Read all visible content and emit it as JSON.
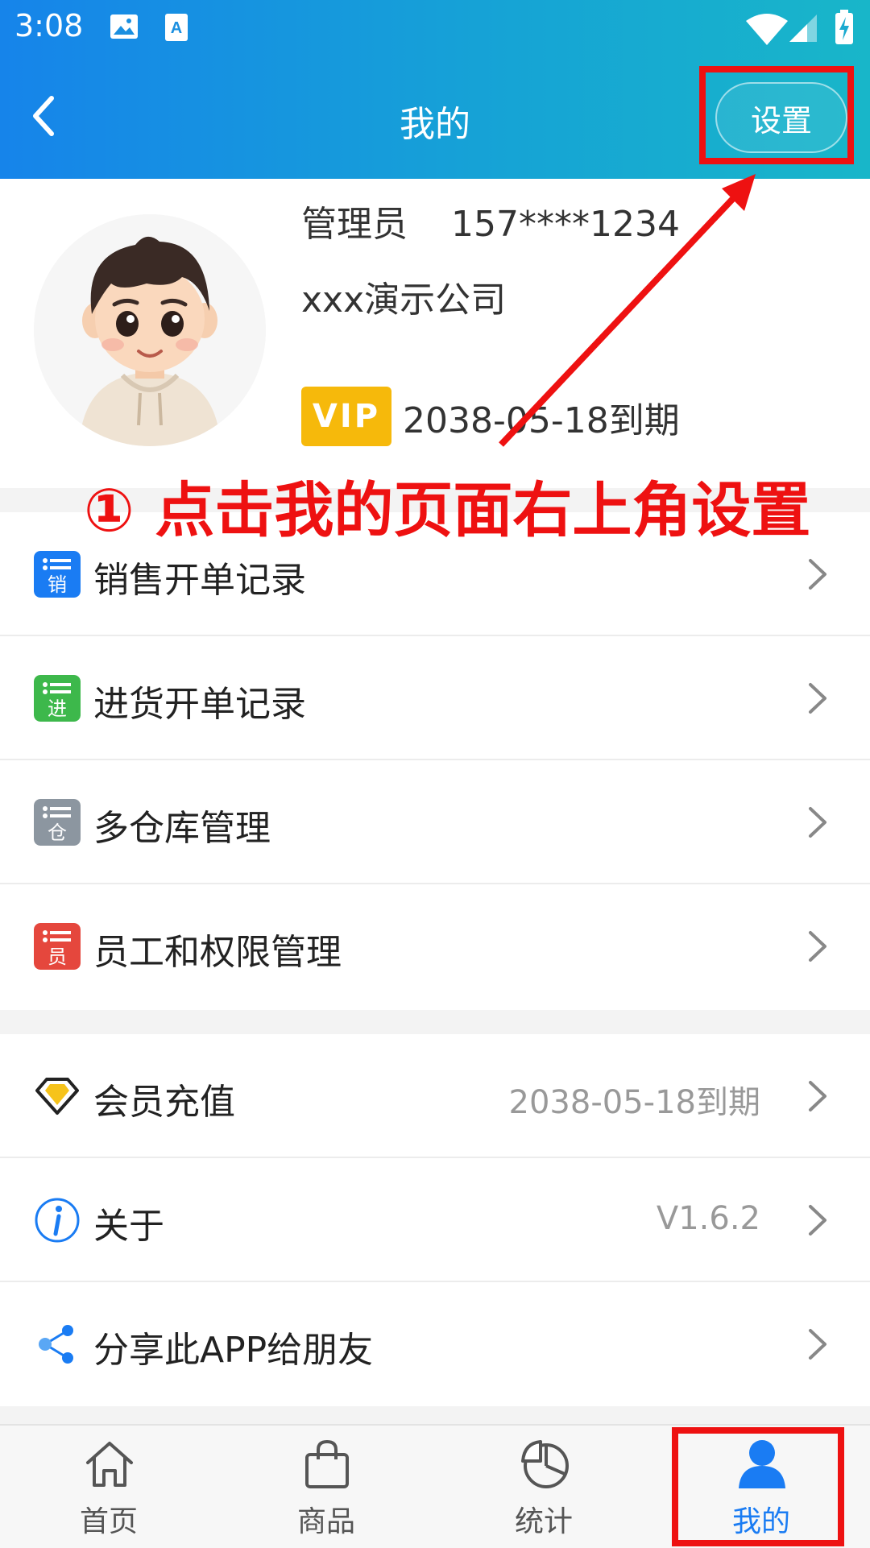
{
  "status_bar": {
    "time": "3:08"
  },
  "header": {
    "title": "我的",
    "settings_label": "设置"
  },
  "profile": {
    "role": "管理员",
    "phone": "157****1234",
    "company": "xxx演示公司",
    "vip_label": "VIP",
    "expiry": "2038-05-18到期"
  },
  "annotation": {
    "text": "① 点击我的页面右上角设置"
  },
  "menu1": {
    "items": [
      {
        "label": "销售开单记录",
        "icon_char": "销",
        "icon": "sales-record-icon",
        "color": "#1a7cf3"
      },
      {
        "label": "进货开单记录",
        "icon_char": "进",
        "icon": "purchase-record-icon",
        "color": "#3db84b"
      },
      {
        "label": "多仓库管理",
        "icon_char": "仓",
        "icon": "warehouse-icon",
        "color": "#8c96a0"
      },
      {
        "label": "员工和权限管理",
        "icon_char": "员",
        "icon": "staff-icon",
        "color": "#e5473d"
      }
    ]
  },
  "menu2": {
    "items": [
      {
        "label": "会员充值",
        "value": "2038-05-18到期",
        "icon": "diamond-icon"
      },
      {
        "label": "关于",
        "value": "V1.6.2",
        "icon": "info-icon"
      },
      {
        "label": "分享此APP给朋友",
        "value": "",
        "icon": "share-icon"
      }
    ]
  },
  "tabs": [
    {
      "label": "首页",
      "icon": "home-icon"
    },
    {
      "label": "商品",
      "icon": "bag-icon"
    },
    {
      "label": "统计",
      "icon": "pie-chart-icon"
    },
    {
      "label": "我的",
      "icon": "user-icon",
      "active": true
    }
  ],
  "colors": {
    "accent": "#1a7cf3",
    "highlight": "#ee1111",
    "vip": "#f6b90b"
  }
}
